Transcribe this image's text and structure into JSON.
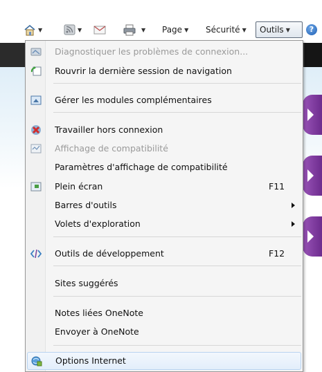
{
  "toolbar": {
    "page_label": "Page",
    "security_label": "Sécurité",
    "tools_label": "Outils",
    "help_glyph": "?",
    "icons": [
      "home-icon",
      "feeds-icon",
      "mail-icon",
      "print-icon",
      "help-icon"
    ]
  },
  "menu": {
    "items": [
      {
        "label": "Diagnostiquer les problèmes de connexion...",
        "enabled": false,
        "icon": "diagnose-icon"
      },
      {
        "label": "Rouvrir la dernière session de navigation",
        "enabled": true,
        "icon": "reopen-session-icon"
      },
      {
        "label": "Gérer les modules complémentaires",
        "enabled": true,
        "icon": "addons-icon"
      },
      {
        "label": "Travailler hors connexion",
        "enabled": true,
        "icon": "offline-icon"
      },
      {
        "label": "Affichage de compatibilité",
        "enabled": false,
        "icon": "compat-view-icon"
      },
      {
        "label": "Paramètres d'affichage de compatibilité",
        "enabled": true
      },
      {
        "label": "Plein écran",
        "shortcut": "F11",
        "enabled": true,
        "icon": "fullscreen-icon"
      },
      {
        "label": "Barres d'outils",
        "submenu": true,
        "enabled": true
      },
      {
        "label": "Volets d'exploration",
        "submenu": true,
        "enabled": true
      },
      {
        "label": "Outils de développement",
        "shortcut": "F12",
        "enabled": true,
        "icon": "developer-tools-icon"
      },
      {
        "label": "Sites suggérés",
        "enabled": true
      },
      {
        "label": "Notes liées OneNote",
        "enabled": true
      },
      {
        "label": "Envoyer à OneNote",
        "enabled": true
      },
      {
        "label": "Options Internet",
        "enabled": true,
        "hovered": true,
        "icon": "internet-options-icon"
      }
    ]
  },
  "colors": {
    "menu_bg": "#f5f5f5",
    "hover_border": "#b8d3f0",
    "disabled_text": "#9a9a9a",
    "accent_purple": "#7b3a9c"
  }
}
